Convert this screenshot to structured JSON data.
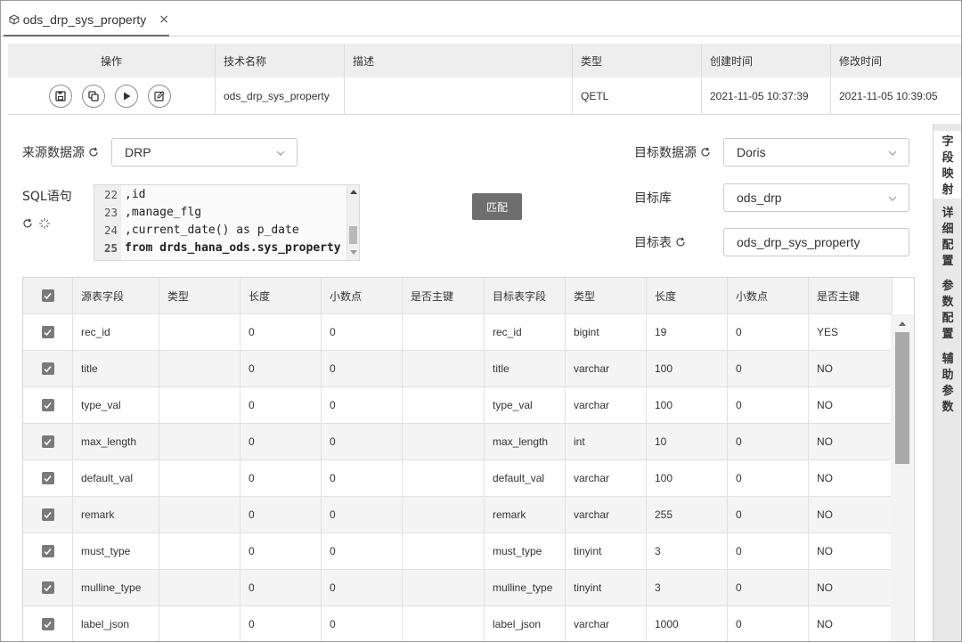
{
  "tab": {
    "label": "ods_drp_sys_property",
    "close": "×"
  },
  "info": {
    "headers": [
      "操作",
      "技术名称",
      "描述",
      "类型",
      "创建时间",
      "修改时间"
    ],
    "values": {
      "tech_name": "ods_drp_sys_property",
      "desc": "",
      "type": "QETL",
      "created": "2021-11-05 10:37:39",
      "modified": "2021-11-05 10:39:05"
    }
  },
  "source": {
    "label": "来源数据源",
    "value": "DRP"
  },
  "sql": {
    "label": "SQL语句",
    "lines": [
      {
        "n": "22",
        "code": ",id"
      },
      {
        "n": "23",
        "code": ",manage_flg"
      },
      {
        "n": "24",
        "code": ",current_date() as p_date"
      },
      {
        "n": "25",
        "code": "from drds_hana_ods.sys_property"
      }
    ]
  },
  "match_button": "匹配",
  "target": {
    "datasource_label": "目标数据源",
    "datasource_value": "Doris",
    "db_label": "目标库",
    "db_value": "ods_drp",
    "table_label": "目标表",
    "table_value": "ods_drp_sys_property"
  },
  "grid": {
    "headers": [
      "源表字段",
      "类型",
      "长度",
      "小数点",
      "是否主键",
      "目标表字段",
      "类型",
      "长度",
      "小数点",
      "是否主键"
    ],
    "rows": [
      [
        "rec_id",
        "",
        "0",
        "0",
        "",
        "rec_id",
        "bigint",
        "19",
        "0",
        "YES"
      ],
      [
        "title",
        "",
        "0",
        "0",
        "",
        "title",
        "varchar",
        "100",
        "0",
        "NO"
      ],
      [
        "type_val",
        "",
        "0",
        "0",
        "",
        "type_val",
        "varchar",
        "100",
        "0",
        "NO"
      ],
      [
        "max_length",
        "",
        "0",
        "0",
        "",
        "max_length",
        "int",
        "10",
        "0",
        "NO"
      ],
      [
        "default_val",
        "",
        "0",
        "0",
        "",
        "default_val",
        "varchar",
        "100",
        "0",
        "NO"
      ],
      [
        "remark",
        "",
        "0",
        "0",
        "",
        "remark",
        "varchar",
        "255",
        "0",
        "NO"
      ],
      [
        "must_type",
        "",
        "0",
        "0",
        "",
        "must_type",
        "tinyint",
        "3",
        "0",
        "NO"
      ],
      [
        "mulline_type",
        "",
        "0",
        "0",
        "",
        "mulline_type",
        "tinyint",
        "3",
        "0",
        "NO"
      ],
      [
        "label_json",
        "",
        "0",
        "0",
        "",
        "label_json",
        "varchar",
        "1000",
        "0",
        "NO"
      ]
    ]
  },
  "side_tabs": [
    "字段映射",
    "详细配置",
    "参数配置",
    "辅助参数"
  ]
}
